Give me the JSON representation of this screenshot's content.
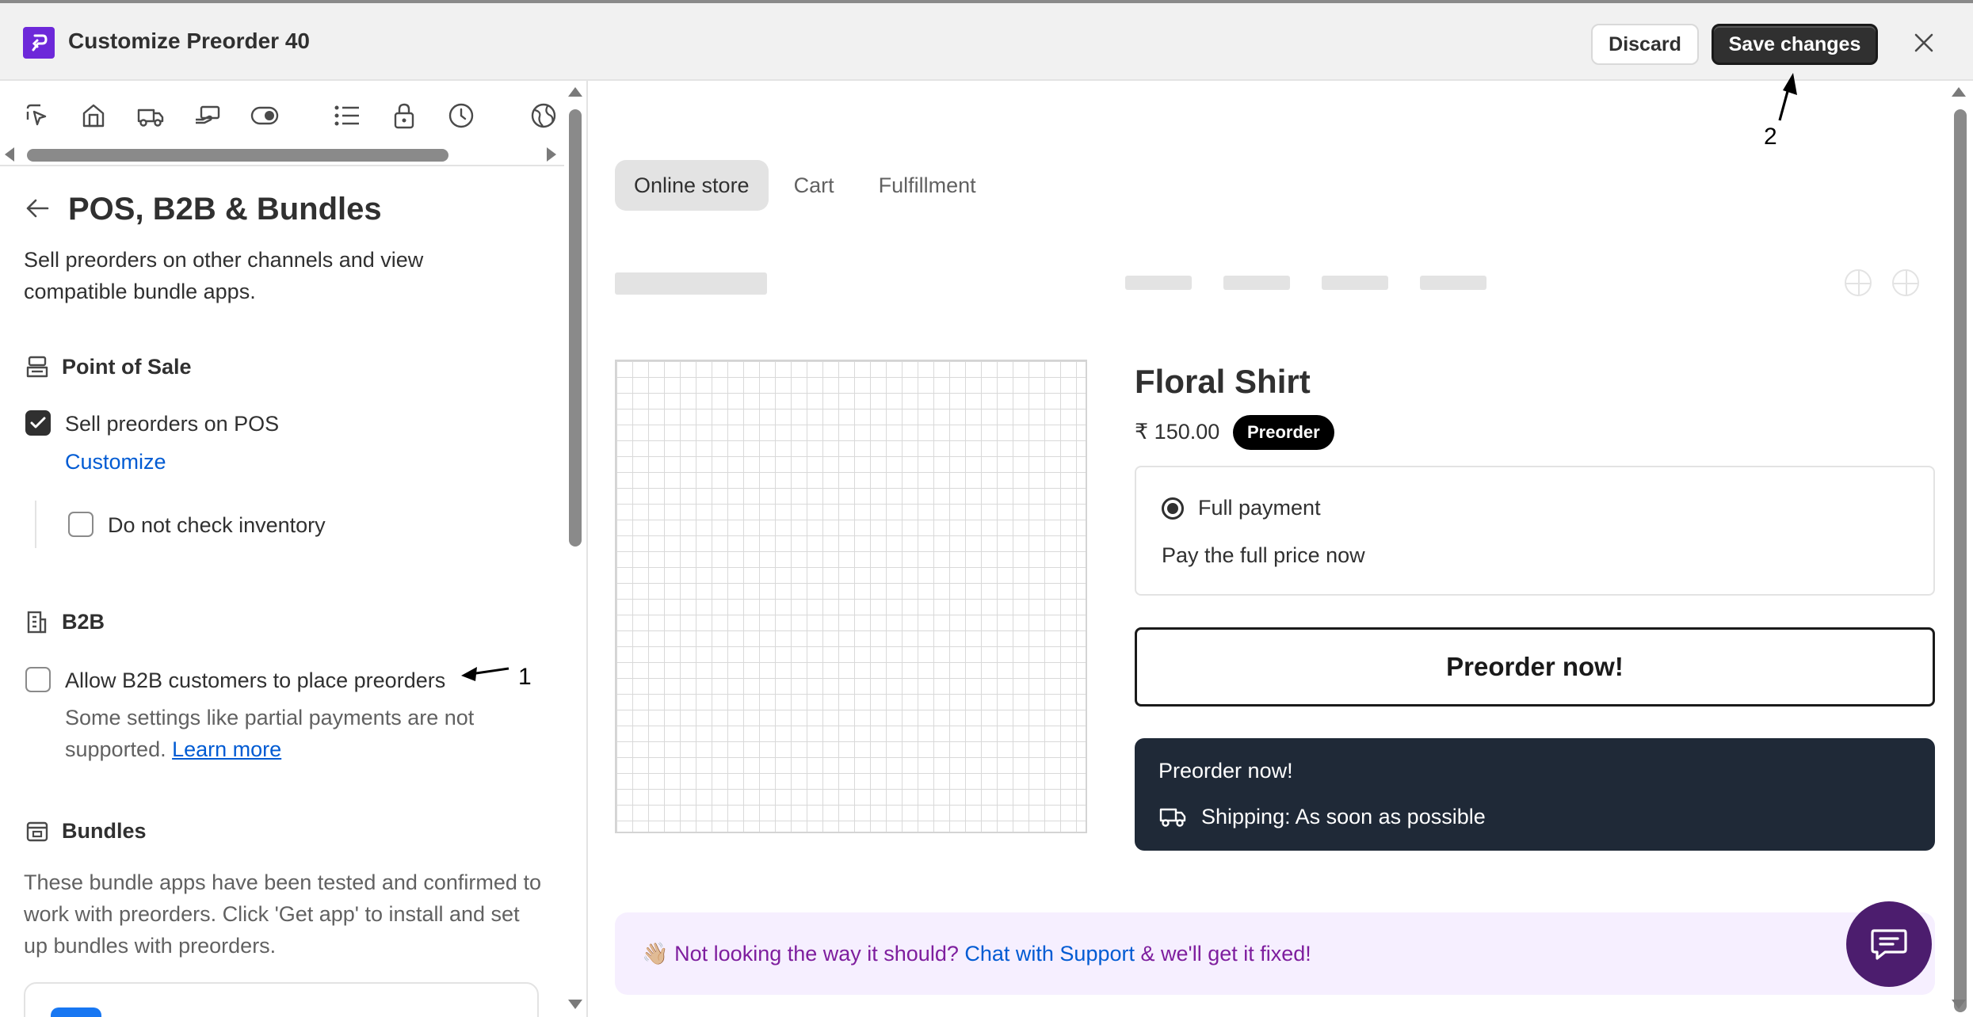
{
  "header": {
    "title": "Customize Preorder 40",
    "discard_label": "Discard",
    "save_label": "Save changes"
  },
  "sidebar": {
    "icon_tabs": [
      "cursor-icon",
      "store-icon",
      "truck-icon",
      "hand-card-icon",
      "toggle-icon",
      "list-icon",
      "lock-icon",
      "clock-icon",
      "globe-icon"
    ],
    "section_title": "POS, B2B & Bundles",
    "section_description": "Sell preorders on other channels and view compatible bundle apps.",
    "point_of_sale": {
      "title": "Point of Sale",
      "sell_on_pos_label": "Sell preorders on POS",
      "sell_on_pos_checked": true,
      "customize_link": "Customize",
      "no_inventory_label": "Do not check inventory",
      "no_inventory_checked": false
    },
    "b2b": {
      "title": "B2B",
      "allow_label": "Allow B2B customers to place preorders",
      "allow_checked": false,
      "help_text": "Some settings like partial payments are not supported.",
      "learn_more": "Learn more"
    },
    "bundles": {
      "title": "Bundles",
      "description": "These bundle apps have been tested and confirmed to work with preorders. Click 'Get app' to install and set up bundles with preorders."
    }
  },
  "preview": {
    "tabs": [
      "Online store",
      "Cart",
      "Fulfillment"
    ],
    "active_tab": "Online store",
    "product": {
      "name": "Floral Shirt",
      "price": "₹ 150.00",
      "badge": "Preorder"
    },
    "payment": {
      "option_label": "Full payment",
      "option_desc": "Pay the full price now"
    },
    "preorder_button": "Preorder now!",
    "shipping": {
      "title": "Preorder now!",
      "text": "Shipping: As soon as possible"
    },
    "support": {
      "emoji": "👋🏼",
      "prefix": "Not looking the way it should?",
      "link": "Chat with Support",
      "suffix": "& we'll get it fixed!"
    }
  },
  "annotations": {
    "one": "1",
    "two": "2"
  },
  "colors": {
    "accent_purple": "#6d28d9",
    "link_blue": "#005bd3",
    "dark_button": "#303030",
    "shipping_bg": "#1f2937",
    "banner_bg": "#f6efff",
    "chat_bubble": "#4c1d6e"
  }
}
